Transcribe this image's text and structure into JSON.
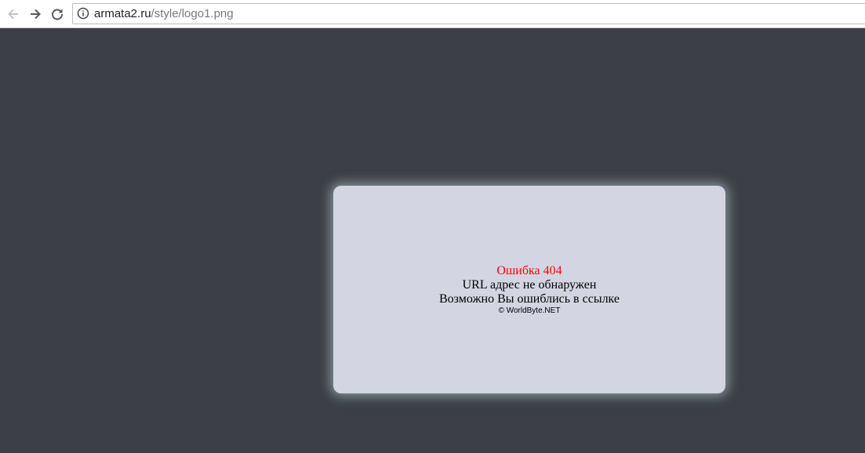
{
  "browser": {
    "url_host": "armata2.ru",
    "url_path": "/style/logo1.png",
    "icons": {
      "back": "back-arrow-icon",
      "forward": "forward-arrow-icon",
      "reload": "reload-icon",
      "info": "info-icon"
    }
  },
  "error_page": {
    "title": "Ошибка 404",
    "line1": "URL адрес не обнаружен",
    "line2": "Возможно Вы ошиблись в ссылке",
    "copyright": "© WorldByte.NET"
  },
  "colors": {
    "page_background": "#3c3f46",
    "card_background": "#d3d5e2",
    "error_title": "#ff0000"
  }
}
